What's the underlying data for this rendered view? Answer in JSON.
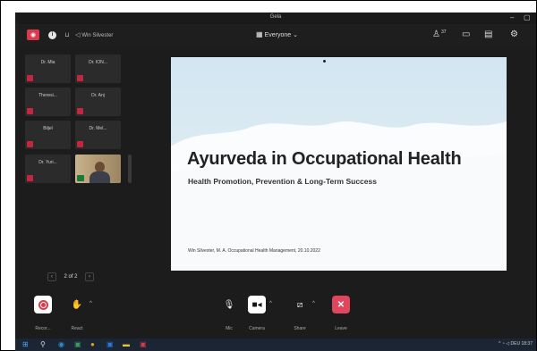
{
  "window": {
    "title": "Gela"
  },
  "toolbar": {
    "speaker_label": "Win Silvester",
    "audience_label": "Everyone",
    "people_count": "37"
  },
  "participants": [
    {
      "name": "Dr. Mia"
    },
    {
      "name": "Dr. ION..."
    },
    {
      "name": "Theresi..."
    },
    {
      "name": "Dr. Anj"
    },
    {
      "name": "Biljel"
    },
    {
      "name": "Dr. Mel..."
    },
    {
      "name": "Dr. Yuri..."
    }
  ],
  "pager": {
    "label": "2 of 2"
  },
  "slide": {
    "title": "Ayurveda in Occupational Health",
    "subtitle": "Health Promotion, Prevention & Long-Term Success",
    "footer": "Win Silvester, M. A. Occupational Health Management, 20.10.2022"
  },
  "controls": {
    "record": "Recor...",
    "react": "React",
    "mic": "Mic",
    "camera": "Camera",
    "share": "Share",
    "leave": "Leave"
  },
  "taskbar": {
    "time": "18:37",
    "lang": "DEU",
    "tray_prefix": "^"
  },
  "colors": {
    "accent_red": "#d93a4e",
    "leave_red": "#e0475c",
    "slide_bg": "#d2e6f1"
  }
}
